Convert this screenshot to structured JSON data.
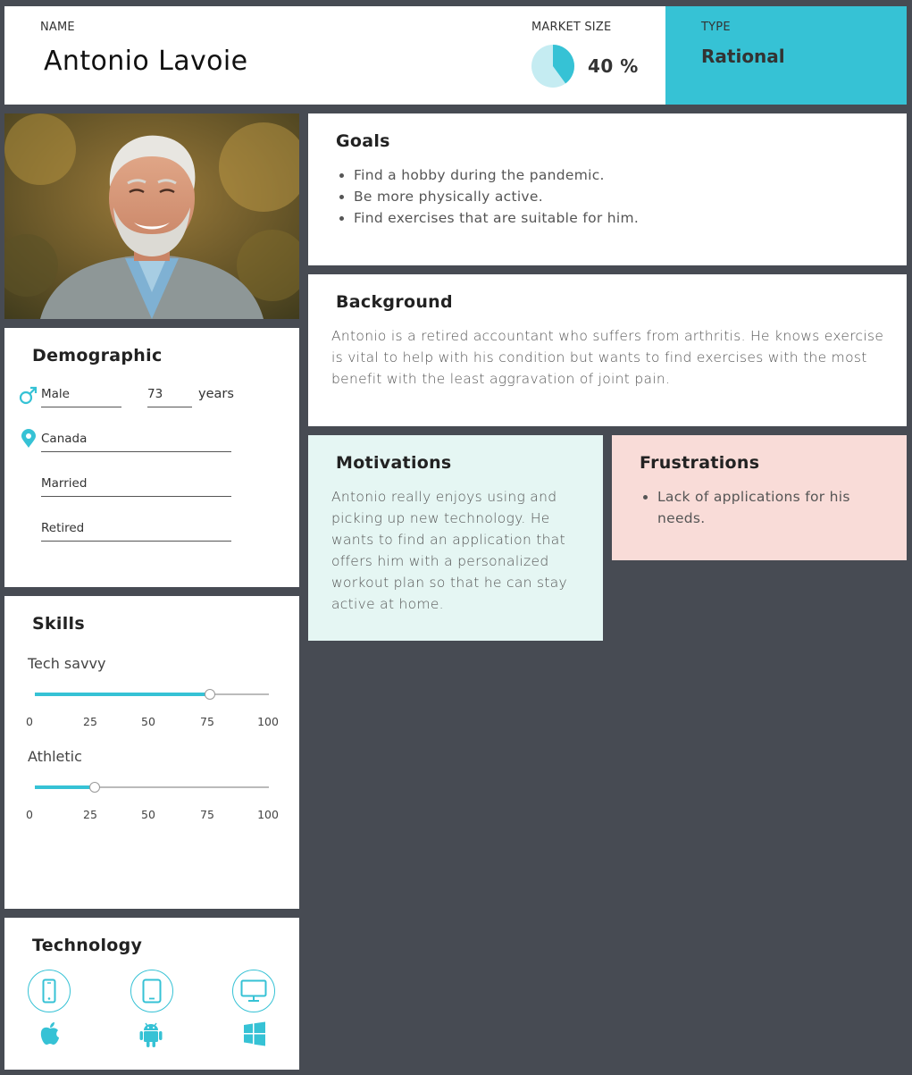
{
  "header": {
    "name_label": "NAME",
    "name": "Antonio Lavoie",
    "market_label": "MARKET SIZE",
    "market_value": "40 %",
    "market_fraction": 0.4,
    "type_label": "TYPE",
    "type": "Rational"
  },
  "colors": {
    "accent": "#36c2d5",
    "background": "#474b53",
    "motivations_bg": "#e5f6f3",
    "frustrations_bg": "#f9dcd8",
    "pie_light": "#c5ecf2"
  },
  "photo": {
    "icon": "portrait-photo"
  },
  "demographic": {
    "title": "Demographic",
    "gender": "Male",
    "age": "73",
    "age_unit": "years",
    "location": "Canada",
    "marital": "Married",
    "occupation": "Retired",
    "icons": [
      "male-icon",
      "location-pin-icon"
    ]
  },
  "skills": {
    "title": "Skills",
    "ticks": [
      "0",
      "25",
      "50",
      "75",
      "100"
    ],
    "items": [
      {
        "name": "Tech savvy",
        "value": 75
      },
      {
        "name": "Athletic",
        "value": 25
      }
    ]
  },
  "technology": {
    "title": "Technology",
    "devices": [
      "smartphone-icon",
      "tablet-icon",
      "desktop-icon"
    ],
    "os": [
      "apple-icon",
      "android-icon",
      "windows-icon"
    ]
  },
  "goals": {
    "title": "Goals",
    "items": [
      "Find a hobby during the pandemic.",
      "Be more physically active.",
      "Find exercises that are suitable for him."
    ]
  },
  "background": {
    "title": "Background",
    "text": "Antonio is a retired accountant who suffers from arthritis. He knows exercise is vital to help with his condition but wants to find exercises with the most benefit with the least aggravation of joint pain."
  },
  "motivations": {
    "title": "Motivations",
    "text": "Antonio really enjoys using and picking up new technology. He wants to find an application that offers him with a personalized workout plan so that he can stay active at home."
  },
  "frustrations": {
    "title": "Frustrations",
    "items": [
      "Lack of applications for his needs."
    ]
  }
}
